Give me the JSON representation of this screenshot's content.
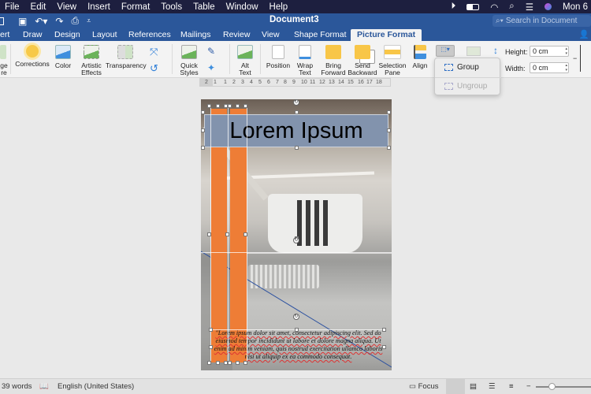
{
  "menubar": {
    "items": [
      "File",
      "Edit",
      "View",
      "Insert",
      "Format",
      "Tools",
      "Table",
      "Window",
      "Help"
    ],
    "clock": "Mon 6",
    "status_icons": [
      "play-icon",
      "battery-icon",
      "wifi-icon",
      "spotlight-icon",
      "control-center-icon",
      "siri-icon"
    ]
  },
  "titlebar": {
    "document_title": "Document3",
    "search_placeholder": "Search in Document",
    "quick_access": [
      "save-icon",
      "undo-icon",
      "redo-icon",
      "print-icon",
      "customize-icon"
    ]
  },
  "tabs": [
    {
      "label": "ert"
    },
    {
      "label": "Draw"
    },
    {
      "label": "Design"
    },
    {
      "label": "Layout"
    },
    {
      "label": "References"
    },
    {
      "label": "Mailings"
    },
    {
      "label": "Review"
    },
    {
      "label": "View"
    },
    {
      "label": "Shape Format"
    },
    {
      "label": "Picture Format",
      "active": true
    }
  ],
  "ribbon": {
    "change_picture": [
      "ge",
      "re"
    ],
    "corrections": "Corrections",
    "color": "Color",
    "artistic_effects": [
      "Artistic",
      "Effects"
    ],
    "transparency": "Transparency",
    "quick_styles": [
      "Quick",
      "Styles"
    ],
    "alt_text": [
      "Alt",
      "Text"
    ],
    "position": "Position",
    "wrap_text": [
      "Wrap",
      "Text"
    ],
    "bring_forward": [
      "Bring",
      "Forward"
    ],
    "send_backward": [
      "Send",
      "Backward"
    ],
    "selection_pane": [
      "Selection",
      "Pane"
    ],
    "align": "Align",
    "height_label": "Height:",
    "height_value": "0 cm",
    "width_label": "Width:",
    "width_value": "0 cm"
  },
  "group_menu": {
    "group": "Group",
    "ungroup": "Ungroup"
  },
  "ruler": {
    "ticks": [
      "2",
      "1",
      "1",
      "2",
      "3",
      "4",
      "5",
      "6",
      "7",
      "8",
      "9",
      "10",
      "11",
      "12",
      "13",
      "14",
      "15",
      "16",
      "17",
      "18"
    ]
  },
  "document": {
    "title_text": "Lorem Ipsum",
    "caption": "\"Lorem ipsum dolor sit amet, consectetur adipiscing elit. Sed do eiusmod tempor incididunt ut labore et dolore magna aliqua. Ut enim ad minim veniam, quis nostrud exercitation ullamco laboris nisi ut aliquip ex ea commodo consequat.",
    "accent_orange": "#ee7d36",
    "title_box_color": "#8293ad"
  },
  "statusbar": {
    "word_count": "39 words",
    "language": "English (United States)",
    "focus": "Focus"
  }
}
